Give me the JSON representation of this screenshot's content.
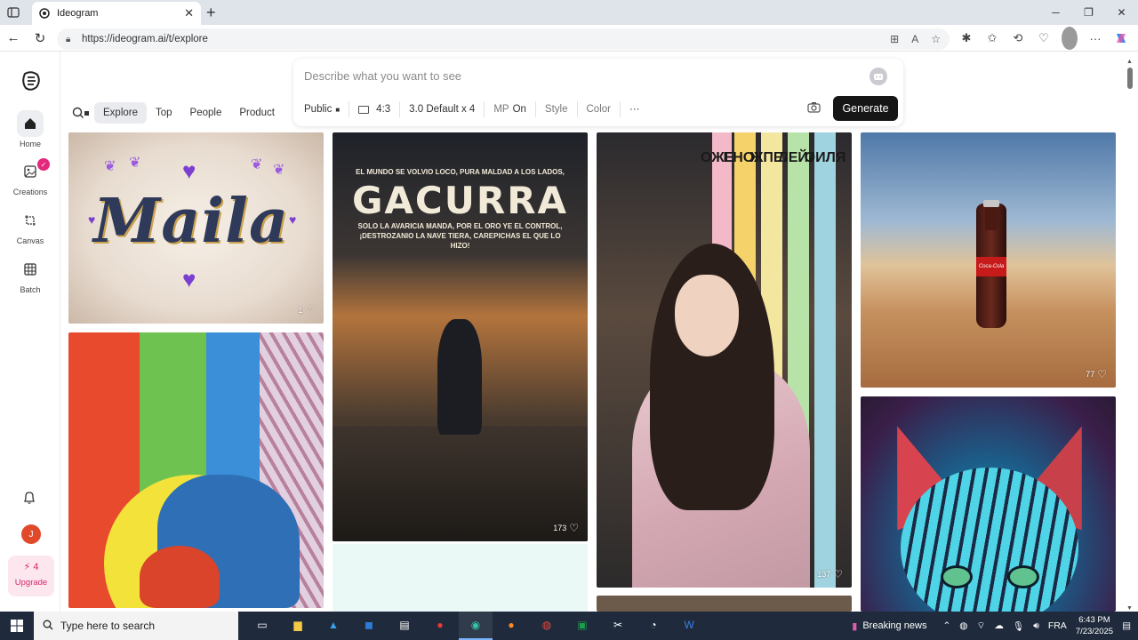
{
  "browser": {
    "tab_title": "Ideogram",
    "url": "https://ideogram.ai/t/explore"
  },
  "sidebar": {
    "items": [
      {
        "label": "Home",
        "icon": "home-icon"
      },
      {
        "label": "Creations",
        "icon": "image-icon"
      },
      {
        "label": "Canvas",
        "icon": "canvas-icon"
      },
      {
        "label": "Batch",
        "icon": "grid-icon"
      }
    ],
    "user_initial": "J",
    "upgrade_count": "4",
    "upgrade_label": "Upgrade"
  },
  "prompt": {
    "placeholder": "Describe what you want to see",
    "options": {
      "visibility": "Public",
      "aspect": "4:3",
      "model": "3.0 Default x 4",
      "mp_label": "MP",
      "mp_value": "On",
      "style": "Style",
      "color": "Color",
      "more": "···"
    },
    "generate_label": "Generate"
  },
  "filters": {
    "tabs": [
      "Explore",
      "Top",
      "People",
      "Product"
    ],
    "active": "Explore"
  },
  "gallery": [
    {
      "id": "maila",
      "likes": "1",
      "text": "Maila"
    },
    {
      "id": "gacurra",
      "likes": "173",
      "line1": "EL MUNDO SE VOLVIO LOCO, PURA MALDAD A LOS LADOS,",
      "title": "GACURRA",
      "line2": "SOLO LA AVARICIA MANDA, POR EL ORO YE EL CONTROL, ¡DESTROZANIO LA NAVE TIERA, CAREPICHAS EL QUE LO HIZO!"
    },
    {
      "id": "kimono",
      "likes": "137"
    },
    {
      "id": "cola",
      "likes": "77",
      "label": "Coca-Cola"
    },
    {
      "id": "comic"
    },
    {
      "id": "cat"
    }
  ],
  "taskbar": {
    "search_placeholder": "Type here to search",
    "news": "Breaking news",
    "lang": "FRA",
    "time": "6:43 PM",
    "date": "7/23/2025"
  },
  "colors": {
    "accent": "#e4287c",
    "generate_bg": "#161616",
    "taskbar_bg": "#1f2b3c"
  }
}
